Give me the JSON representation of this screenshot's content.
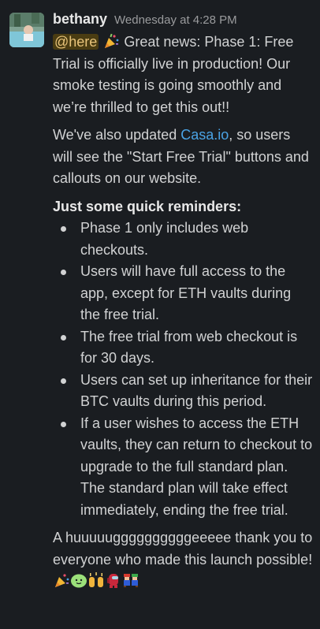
{
  "message": {
    "author": "bethany",
    "timestamp": "Wednesday at 4:28 PM",
    "mention": "@here",
    "intro_text": " Great news: Phase 1: Free Trial is officially live in production! Our smoke testing is going smoothly and we’re thrilled to get this out!!",
    "para2_before": "We've also updated ",
    "para2_link": "Casa.io",
    "para2_after": ", so users will see the \"Start Free Trial\" buttons and callouts on our website.",
    "reminders_heading": "Just some quick reminders:",
    "reminders": [
      "Phase 1 only includes web checkouts.",
      "Users will have full access to the app, except for ETH vaults during the free trial.",
      "The free trial from web checkout is for 30 days.",
      "Users can set up inheritance for their BTC vaults during this period.",
      "If a user wishes to access the ETH vaults, they can return to checkout to upgrade to the full standard plan. The standard plan will take effect immediately, ending the free trial."
    ],
    "closing_text": "A huuuuuggggggggggeeeee thank you to everyone who made this launch possible! ",
    "emojis": [
      "party-popper",
      "blob-face",
      "raised-hands",
      "among-us-crewmate",
      "mario-luigi"
    ]
  }
}
